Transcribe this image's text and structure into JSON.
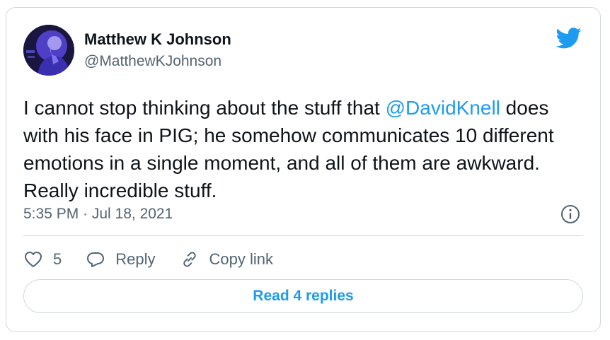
{
  "author": {
    "name": "Matthew K Johnson",
    "handle": "@MatthewKJohnson"
  },
  "tweet": {
    "text_before": "I cannot stop thinking about the stuff that ",
    "mention": "@DavidKnell",
    "text_after": " does with his face in PIG; he somehow communicates 10 different emotions in a single moment, and all of them are awkward. Really incredible stuff.",
    "timestamp": "5:35 PM · Jul 18, 2021"
  },
  "actions": {
    "like_count": "5",
    "reply_label": "Reply",
    "copy_link_label": "Copy link"
  },
  "replies_button": "Read 4 replies",
  "colors": {
    "accent": "#1d9bf0",
    "text": "#0f1419",
    "muted": "#536471",
    "border": "#cfd9de"
  },
  "icons": [
    "twitter-bird-icon",
    "info-icon",
    "heart-icon",
    "reply-icon",
    "link-icon"
  ]
}
